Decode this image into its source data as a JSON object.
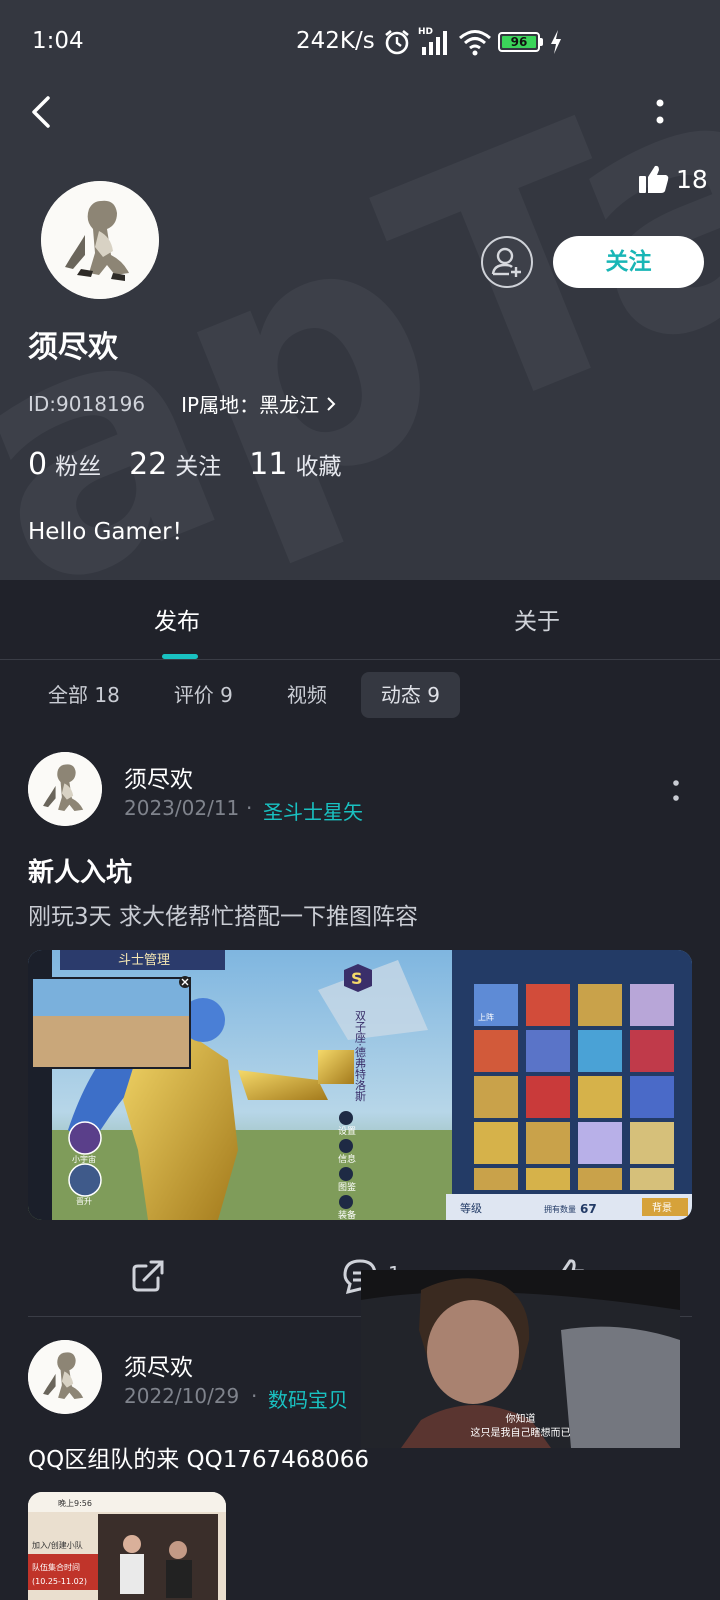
{
  "status_bar": {
    "time": "1:04",
    "net_speed": "242K/s",
    "hd_label": "HD",
    "battery": "96"
  },
  "profile": {
    "likes": "18",
    "follow_label": "关注",
    "username": "须尽欢",
    "id_text": "ID:9018196",
    "ip_text": "IP属地：黑龙江",
    "fans_count": "0",
    "fans_label": "粉丝",
    "following_count": "22",
    "following_label": "关注",
    "favorites_count": "11",
    "favorites_label": "收藏",
    "bio": "Hello Gamer！"
  },
  "tabs": [
    {
      "label": "发布"
    },
    {
      "label": "关于"
    }
  ],
  "filters": [
    {
      "label": "全部 18"
    },
    {
      "label": "评价 9"
    },
    {
      "label": "视频"
    },
    {
      "label": "动态 9"
    }
  ],
  "posts": [
    {
      "author": "须尽欢",
      "date": "2023/02/11",
      "separator": "·",
      "game": "圣斗士星矢",
      "title": "新人入坑",
      "text": "刚玩3天 求大佬帮忙搭配一下推图阵容",
      "comment_count": "1",
      "image": {
        "header": "斗士管理",
        "badge": "S",
        "name_vertical": "双子座·德弗特洛斯",
        "menu": [
          "设置",
          "信息",
          "图鉴",
          "装备"
        ],
        "bottom_left": "等级",
        "count_label": "拥有数量",
        "count": "67",
        "right_btn": "背景",
        "left_icons": [
          "小宇宙",
          "晋升"
        ],
        "card_tag": "上阵"
      }
    },
    {
      "author": "须尽欢",
      "date": "2022/10/29",
      "separator": "·",
      "game": "数码宝贝",
      "text": "QQ区组队的来 QQ1767468066",
      "thumb": {
        "time": "晚上9:56",
        "label1": "加入/创建小队",
        "label2": "队伍集合时间",
        "dates": "(10.25-11.02)"
      }
    }
  ],
  "float_video": {
    "subtitle_1": "你知道",
    "subtitle_2": "这只是我自己瞎想而已"
  },
  "colors": {
    "accent": "#19c1c1",
    "header_bg": "#343740",
    "page_bg": "#20222a",
    "battery": "#3bd45a"
  },
  "icons": [
    "back-arrow-icon",
    "more-vertical-icon",
    "thumbs-up-icon",
    "add-friend-icon",
    "share-icon",
    "comment-icon",
    "like-icon",
    "alarm-icon",
    "signal-icon",
    "wifi-icon",
    "charging-icon",
    "chevron-right-icon"
  ]
}
